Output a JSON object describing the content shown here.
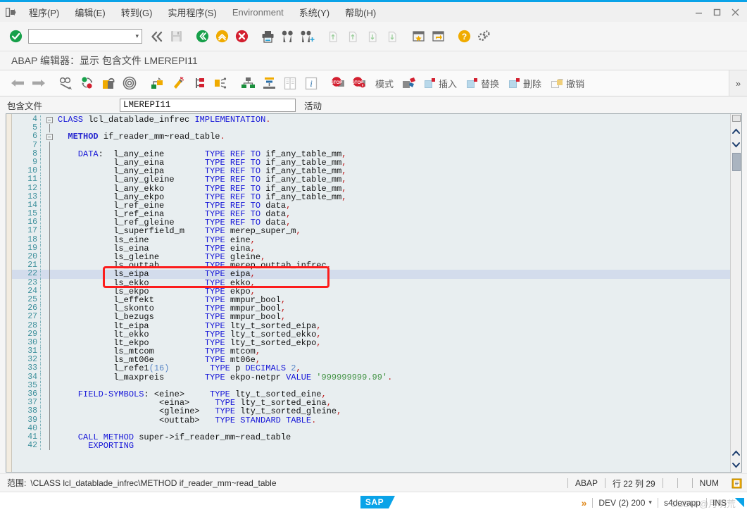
{
  "window": {
    "app_icon": "exit-door-icon",
    "minimize": "—",
    "maximize": "□",
    "close": "✕"
  },
  "menubar": {
    "items": [
      {
        "label": "程序(P)",
        "name": "menu-program"
      },
      {
        "label": "编辑(E)",
        "name": "menu-edit"
      },
      {
        "label": "转到(G)",
        "name": "menu-goto"
      },
      {
        "label": "实用程序(S)",
        "name": "menu-utilities"
      },
      {
        "label": "Environment",
        "name": "menu-environment"
      },
      {
        "label": "系统(Y)",
        "name": "menu-system"
      },
      {
        "label": "帮助(H)",
        "name": "menu-help"
      }
    ]
  },
  "standard_toolbar": {
    "enter_tooltip": "确认",
    "command_value": "",
    "command_placeholder": "",
    "icons": [
      "check-green-icon",
      "command-field",
      "dropdown-arrow-icon",
      "back-double-icon",
      "save-icon",
      "back-green-icon",
      "exit-up-icon",
      "cancel-red-icon",
      "print-icon",
      "find-icon",
      "find-next-icon",
      "first-page-icon",
      "previous-page-icon",
      "next-page-icon",
      "last-page-icon",
      "create-shortcut-icon",
      "new-window-icon",
      "help-icon",
      "customize-local-layout-icon"
    ]
  },
  "title": {
    "text": "ABAP 编辑器：显示 包含文件 LMEREPI11"
  },
  "app_toolbar": {
    "icons": [
      "back-arrow-icon",
      "forward-arrow-icon",
      "display-change-icon",
      "check-syntax-icon",
      "activate-icon",
      "pattern-icon",
      "where-used-icon",
      "pretty-printer-icon",
      "navigation-stack-icon",
      "split-screen-icon",
      "object-list-icon",
      "outline-icon",
      "documentation-icon",
      "info-icon",
      "breakpoint-icon",
      "breakpoint-session-icon"
    ],
    "labels": [
      {
        "label": "模式",
        "name": "mode-button",
        "icon": ""
      },
      {
        "label": "",
        "name": "services-button",
        "icon": "services-icon"
      },
      {
        "label": "插入",
        "name": "insert-button",
        "icon": "insert-icon"
      },
      {
        "label": "替换",
        "name": "replace-button",
        "icon": "replace-icon"
      },
      {
        "label": "删除",
        "name": "delete-button",
        "icon": "delete-icon"
      },
      {
        "label": "撤销",
        "name": "undo-button",
        "icon": "undo-icon"
      }
    ],
    "more": "»"
  },
  "include_row": {
    "label": "包含文件",
    "value": "LMEREPI11",
    "status": "活动"
  },
  "code": {
    "current_line": 22,
    "lines": [
      {
        "n": 4,
        "fold": "minus",
        "indent": 0,
        "tokens": [
          {
            "t": "CLASS ",
            "c": "kw"
          },
          {
            "t": "lcl_datablade_infrec ",
            "c": "id"
          },
          {
            "t": "IMPLEMENTATION",
            "c": "kw"
          },
          {
            "t": ".",
            "c": "pun"
          }
        ]
      },
      {
        "n": 5,
        "fold": "line",
        "indent": 0,
        "tokens": []
      },
      {
        "n": 6,
        "fold": "minus",
        "indent": 2,
        "tokens": [
          {
            "t": "  METHOD ",
            "c": "kw2"
          },
          {
            "t": "if_reader_mm~read_table",
            "c": "id"
          },
          {
            "t": ".",
            "c": "pun"
          }
        ]
      },
      {
        "n": 7,
        "fold": "line",
        "indent": 0,
        "tokens": []
      },
      {
        "n": 8,
        "fold": "line",
        "indent": 0,
        "tokens": [
          {
            "t": "    DATA",
            "c": "kw"
          },
          {
            "t": ":  ",
            "c": "id"
          },
          {
            "t": "l_any_eine        ",
            "c": "id"
          },
          {
            "t": "TYPE REF TO ",
            "c": "kw"
          },
          {
            "t": "if_any_table_mm",
            "c": "id"
          },
          {
            "t": ",",
            "c": "pun"
          }
        ]
      },
      {
        "n": 9,
        "fold": "line",
        "indent": 0,
        "tokens": [
          {
            "t": "           l_any_eina        ",
            "c": "id"
          },
          {
            "t": "TYPE REF TO ",
            "c": "kw"
          },
          {
            "t": "if_any_table_mm",
            "c": "id"
          },
          {
            "t": ",",
            "c": "pun"
          }
        ]
      },
      {
        "n": 10,
        "fold": "line",
        "indent": 0,
        "tokens": [
          {
            "t": "           l_any_eipa        ",
            "c": "id"
          },
          {
            "t": "TYPE REF TO ",
            "c": "kw"
          },
          {
            "t": "if_any_table_mm",
            "c": "id"
          },
          {
            "t": ",",
            "c": "pun"
          }
        ]
      },
      {
        "n": 11,
        "fold": "line",
        "indent": 0,
        "tokens": [
          {
            "t": "           l_any_gleine      ",
            "c": "id"
          },
          {
            "t": "TYPE REF TO ",
            "c": "kw"
          },
          {
            "t": "if_any_table_mm",
            "c": "id"
          },
          {
            "t": ",",
            "c": "pun"
          }
        ]
      },
      {
        "n": 12,
        "fold": "line",
        "indent": 0,
        "tokens": [
          {
            "t": "           l_any_ekko        ",
            "c": "id"
          },
          {
            "t": "TYPE REF TO ",
            "c": "kw"
          },
          {
            "t": "if_any_table_mm",
            "c": "id"
          },
          {
            "t": ",",
            "c": "pun"
          }
        ]
      },
      {
        "n": 13,
        "fold": "line",
        "indent": 0,
        "tokens": [
          {
            "t": "           l_any_ekpo        ",
            "c": "id"
          },
          {
            "t": "TYPE REF TO ",
            "c": "kw"
          },
          {
            "t": "if_any_table_mm",
            "c": "id"
          },
          {
            "t": ",",
            "c": "pun"
          }
        ]
      },
      {
        "n": 14,
        "fold": "line",
        "indent": 0,
        "tokens": [
          {
            "t": "           l_ref_eine        ",
            "c": "id"
          },
          {
            "t": "TYPE REF TO ",
            "c": "kw"
          },
          {
            "t": "data",
            "c": "id"
          },
          {
            "t": ",",
            "c": "pun"
          }
        ]
      },
      {
        "n": 15,
        "fold": "line",
        "indent": 0,
        "tokens": [
          {
            "t": "           l_ref_eina        ",
            "c": "id"
          },
          {
            "t": "TYPE REF TO ",
            "c": "kw"
          },
          {
            "t": "data",
            "c": "id"
          },
          {
            "t": ",",
            "c": "pun"
          }
        ]
      },
      {
        "n": 16,
        "fold": "line",
        "indent": 0,
        "tokens": [
          {
            "t": "           l_ref_gleine      ",
            "c": "id"
          },
          {
            "t": "TYPE REF TO ",
            "c": "kw"
          },
          {
            "t": "data",
            "c": "id"
          },
          {
            "t": ",",
            "c": "pun"
          }
        ]
      },
      {
        "n": 17,
        "fold": "line",
        "indent": 0,
        "tokens": [
          {
            "t": "           l_superfield_m    ",
            "c": "id"
          },
          {
            "t": "TYPE ",
            "c": "kw"
          },
          {
            "t": "merep_super_m",
            "c": "id"
          },
          {
            "t": ",",
            "c": "pun"
          }
        ]
      },
      {
        "n": 18,
        "fold": "line",
        "indent": 0,
        "tokens": [
          {
            "t": "           ls_eine           ",
            "c": "id"
          },
          {
            "t": "TYPE ",
            "c": "kw"
          },
          {
            "t": "eine",
            "c": "id"
          },
          {
            "t": ",",
            "c": "pun"
          }
        ]
      },
      {
        "n": 19,
        "fold": "line",
        "indent": 0,
        "tokens": [
          {
            "t": "           ls_eina           ",
            "c": "id"
          },
          {
            "t": "TYPE ",
            "c": "kw"
          },
          {
            "t": "eina",
            "c": "id"
          },
          {
            "t": ",",
            "c": "pun"
          }
        ]
      },
      {
        "n": 20,
        "fold": "line",
        "indent": 0,
        "tokens": [
          {
            "t": "           ls_gleine         ",
            "c": "id"
          },
          {
            "t": "TYPE ",
            "c": "kw"
          },
          {
            "t": "gleine",
            "c": "id"
          },
          {
            "t": ",",
            "c": "pun"
          }
        ]
      },
      {
        "n": 21,
        "fold": "line",
        "indent": 0,
        "tokens": [
          {
            "t": "           ls_outtab         ",
            "c": "id"
          },
          {
            "t": "TYPE ",
            "c": "kw"
          },
          {
            "t": "merep_outtab_infrec",
            "c": "id"
          },
          {
            "t": ",",
            "c": "pun"
          }
        ]
      },
      {
        "n": 22,
        "fold": "line",
        "indent": 0,
        "tokens": [
          {
            "t": "           ls_eipa           ",
            "c": "id"
          },
          {
            "t": "TYPE ",
            "c": "kw"
          },
          {
            "t": "eipa",
            "c": "id"
          },
          {
            "t": ",",
            "c": "pun"
          }
        ]
      },
      {
        "n": 23,
        "fold": "line",
        "indent": 0,
        "tokens": [
          {
            "t": "           ls_ekko           ",
            "c": "id"
          },
          {
            "t": "TYPE ",
            "c": "kw"
          },
          {
            "t": "ekko",
            "c": "id"
          },
          {
            "t": ",",
            "c": "pun"
          }
        ]
      },
      {
        "n": 24,
        "fold": "line",
        "indent": 0,
        "tokens": [
          {
            "t": "           ls_ekpo           ",
            "c": "id"
          },
          {
            "t": "TYPE ",
            "c": "kw"
          },
          {
            "t": "ekpo",
            "c": "id"
          },
          {
            "t": ",",
            "c": "pun"
          }
        ]
      },
      {
        "n": 25,
        "fold": "line",
        "indent": 0,
        "tokens": [
          {
            "t": "           l_effekt          ",
            "c": "id"
          },
          {
            "t": "TYPE ",
            "c": "kw"
          },
          {
            "t": "mmpur_bool",
            "c": "id"
          },
          {
            "t": ",",
            "c": "pun"
          }
        ]
      },
      {
        "n": 26,
        "fold": "line",
        "indent": 0,
        "tokens": [
          {
            "t": "           l_skonto          ",
            "c": "id"
          },
          {
            "t": "TYPE ",
            "c": "kw"
          },
          {
            "t": "mmpur_bool",
            "c": "id"
          },
          {
            "t": ",",
            "c": "pun"
          }
        ]
      },
      {
        "n": 27,
        "fold": "line",
        "indent": 0,
        "tokens": [
          {
            "t": "           l_bezugs          ",
            "c": "id"
          },
          {
            "t": "TYPE ",
            "c": "kw"
          },
          {
            "t": "mmpur_bool",
            "c": "id"
          },
          {
            "t": ",",
            "c": "pun"
          }
        ]
      },
      {
        "n": 28,
        "fold": "line",
        "indent": 0,
        "tokens": [
          {
            "t": "           lt_eipa           ",
            "c": "id"
          },
          {
            "t": "TYPE ",
            "c": "kw"
          },
          {
            "t": "lty_t_sorted_eipa",
            "c": "id"
          },
          {
            "t": ",",
            "c": "pun"
          }
        ]
      },
      {
        "n": 29,
        "fold": "line",
        "indent": 0,
        "tokens": [
          {
            "t": "           lt_ekko           ",
            "c": "id"
          },
          {
            "t": "TYPE ",
            "c": "kw"
          },
          {
            "t": "lty_t_sorted_ekko",
            "c": "id"
          },
          {
            "t": ",",
            "c": "pun"
          }
        ]
      },
      {
        "n": 30,
        "fold": "line",
        "indent": 0,
        "tokens": [
          {
            "t": "           lt_ekpo           ",
            "c": "id"
          },
          {
            "t": "TYPE ",
            "c": "kw"
          },
          {
            "t": "lty_t_sorted_ekpo",
            "c": "id"
          },
          {
            "t": ",",
            "c": "pun"
          }
        ]
      },
      {
        "n": 31,
        "fold": "line",
        "indent": 0,
        "tokens": [
          {
            "t": "           ls_mtcom          ",
            "c": "id"
          },
          {
            "t": "TYPE ",
            "c": "kw"
          },
          {
            "t": "mtcom",
            "c": "id"
          },
          {
            "t": ",",
            "c": "pun"
          }
        ]
      },
      {
        "n": 32,
        "fold": "line",
        "indent": 0,
        "tokens": [
          {
            "t": "           ls_mt06e          ",
            "c": "id"
          },
          {
            "t": "TYPE ",
            "c": "kw"
          },
          {
            "t": "mt06e",
            "c": "id"
          },
          {
            "t": ",",
            "c": "pun"
          }
        ]
      },
      {
        "n": 33,
        "fold": "line",
        "indent": 0,
        "tokens": [
          {
            "t": "           l_refe1",
            "c": "id"
          },
          {
            "t": "(16)",
            "c": "num"
          },
          {
            "t": "        ",
            "c": "id"
          },
          {
            "t": "TYPE ",
            "c": "kw"
          },
          {
            "t": "p ",
            "c": "id"
          },
          {
            "t": "DECIMALS ",
            "c": "kw"
          },
          {
            "t": "2",
            "c": "num"
          },
          {
            "t": ",",
            "c": "pun"
          }
        ]
      },
      {
        "n": 34,
        "fold": "line",
        "indent": 0,
        "tokens": [
          {
            "t": "           l_maxpreis        ",
            "c": "id"
          },
          {
            "t": "TYPE ",
            "c": "kw"
          },
          {
            "t": "ekpo-netpr ",
            "c": "id"
          },
          {
            "t": "VALUE ",
            "c": "kw"
          },
          {
            "t": "'999999999.99'",
            "c": "str"
          },
          {
            "t": ".",
            "c": "pun"
          }
        ]
      },
      {
        "n": 35,
        "fold": "line",
        "indent": 0,
        "tokens": []
      },
      {
        "n": 36,
        "fold": "line",
        "indent": 0,
        "tokens": [
          {
            "t": "    FIELD-SYMBOLS",
            "c": "kw"
          },
          {
            "t": ": <eine>     ",
            "c": "id"
          },
          {
            "t": "TYPE ",
            "c": "kw"
          },
          {
            "t": "lty_t_sorted_eine",
            "c": "id"
          },
          {
            "t": ",",
            "c": "pun"
          }
        ]
      },
      {
        "n": 37,
        "fold": "line",
        "indent": 0,
        "tokens": [
          {
            "t": "                    <eina>     ",
            "c": "id"
          },
          {
            "t": "TYPE ",
            "c": "kw"
          },
          {
            "t": "lty_t_sorted_eina",
            "c": "id"
          },
          {
            "t": ",",
            "c": "pun"
          }
        ]
      },
      {
        "n": 38,
        "fold": "line",
        "indent": 0,
        "tokens": [
          {
            "t": "                    <gleine>   ",
            "c": "id"
          },
          {
            "t": "TYPE ",
            "c": "kw"
          },
          {
            "t": "lty_t_sorted_gleine",
            "c": "id"
          },
          {
            "t": ",",
            "c": "pun"
          }
        ]
      },
      {
        "n": 39,
        "fold": "line",
        "indent": 0,
        "tokens": [
          {
            "t": "                    <outtab>   ",
            "c": "id"
          },
          {
            "t": "TYPE STANDARD TABLE",
            "c": "kw"
          },
          {
            "t": ".",
            "c": "pun"
          }
        ]
      },
      {
        "n": 40,
        "fold": "line",
        "indent": 0,
        "tokens": []
      },
      {
        "n": 41,
        "fold": "line",
        "indent": 0,
        "tokens": [
          {
            "t": "    CALL METHOD ",
            "c": "kw"
          },
          {
            "t": "super->if_reader_mm~read_table",
            "c": "id"
          }
        ]
      },
      {
        "n": 42,
        "fold": "line",
        "indent": 0,
        "tokens": [
          {
            "t": "      EXPORTING",
            "c": "kw"
          }
        ]
      }
    ]
  },
  "annotation": {
    "type": "red-rectangle",
    "color": "#fc1c1c",
    "covers_lines": "20-22"
  },
  "statusbar": {
    "scope_label": "范围:",
    "scope_value": "\\CLASS lcl_datablade_infrec\\METHOD if_reader_mm~read_table",
    "language": "ABAP",
    "position": "行 22 列 29",
    "empty1": "",
    "empty2": "",
    "mode": "NUM",
    "icon": "clipboard-icon"
  },
  "sapbar": {
    "logo": "SAP",
    "chevrons": "»",
    "system": "DEV (2) 200",
    "server": "s4devapp",
    "insert_mode": "INS",
    "watermark": "CSDN @月明荒"
  }
}
